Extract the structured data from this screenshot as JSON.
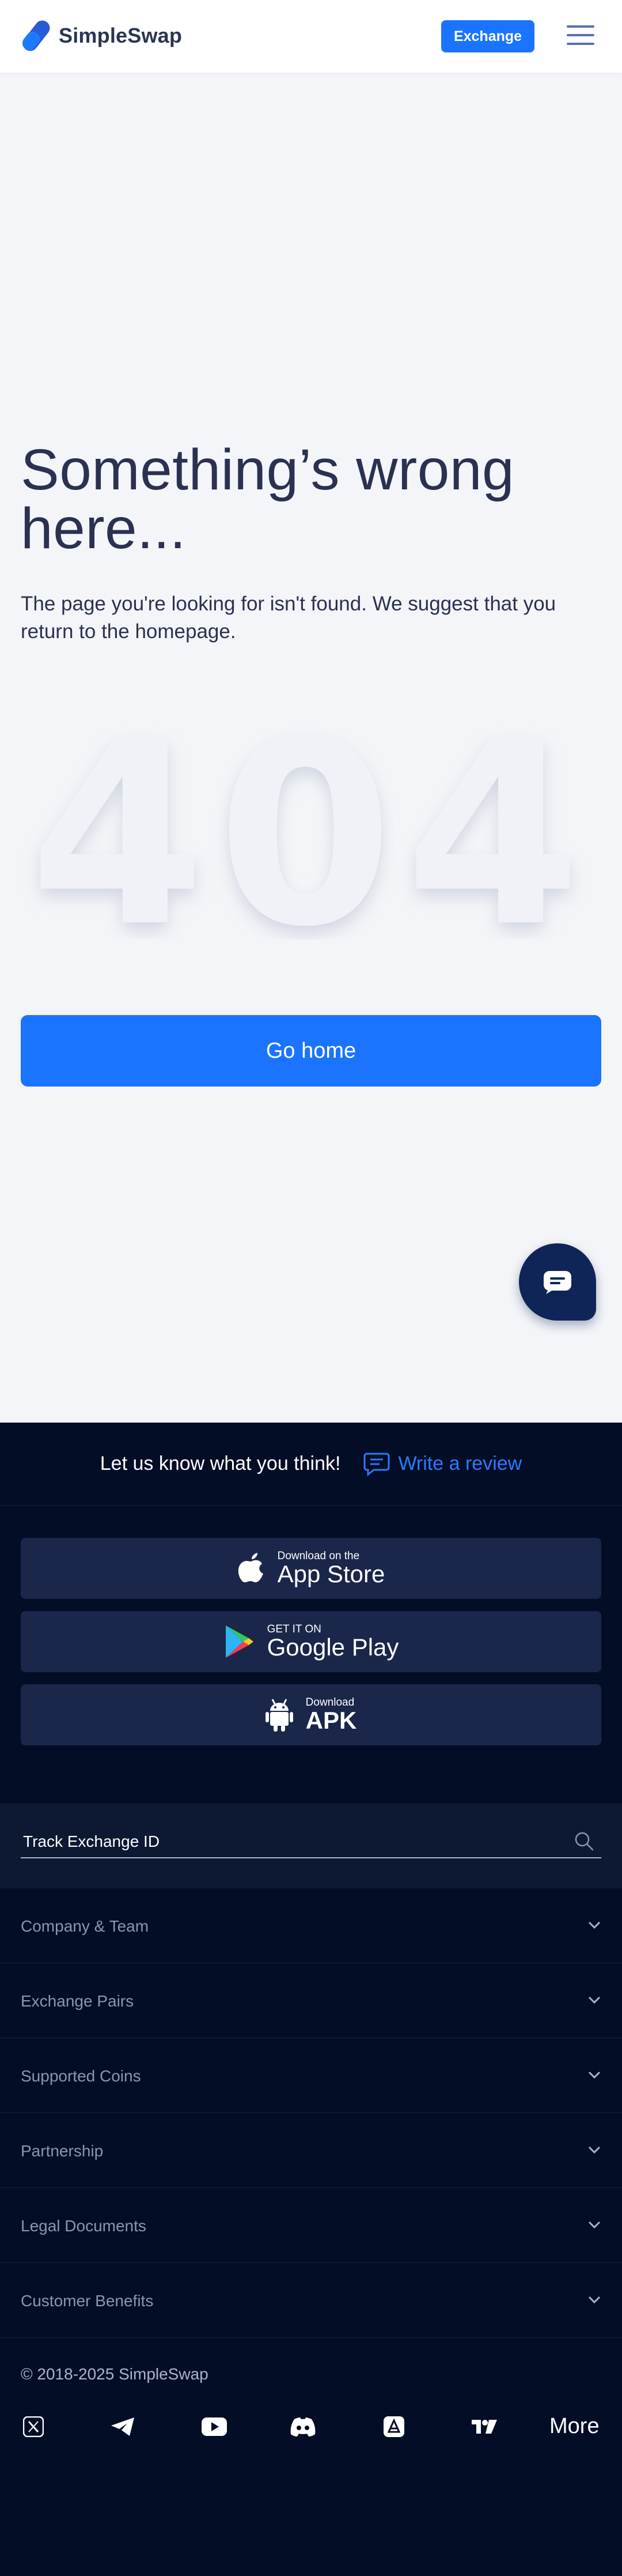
{
  "header": {
    "logo_text": "SimpleSwap",
    "exchange_label": "Exchange",
    "brand_color": "#1a74ff"
  },
  "main": {
    "headline": "Something’s wrong here...",
    "subtext": "The page you're looking for isn't found. We suggest that you return to the homepage.",
    "error_code": "404",
    "go_home_label": "Go home",
    "chat_icon": "chat-bubble-icon"
  },
  "footer": {
    "review_prompt": "Let us know what you think!",
    "review_link": "Write a review",
    "app_store": {
      "small": "Download on the",
      "large": "App Store",
      "icon": "apple-icon"
    },
    "google_play": {
      "small": "GET IT ON",
      "large": "Google Play",
      "icon": "google-play-icon"
    },
    "apk": {
      "small": "Download",
      "large": "APK",
      "icon": "android-icon"
    },
    "track_placeholder": "Track Exchange ID",
    "sections": [
      {
        "label": "Company & Team"
      },
      {
        "label": "Exchange Pairs"
      },
      {
        "label": "Supported Coins"
      },
      {
        "label": "Partnership"
      },
      {
        "label": "Legal Documents"
      },
      {
        "label": "Customer Benefits"
      }
    ],
    "copyright": "© 2018-2025 SimpleSwap",
    "social_icons": [
      "x-icon",
      "telegram-icon",
      "youtube-icon",
      "discord-icon",
      "coinmarketcap-icon",
      "tradingview-icon"
    ],
    "more_label": "More"
  }
}
